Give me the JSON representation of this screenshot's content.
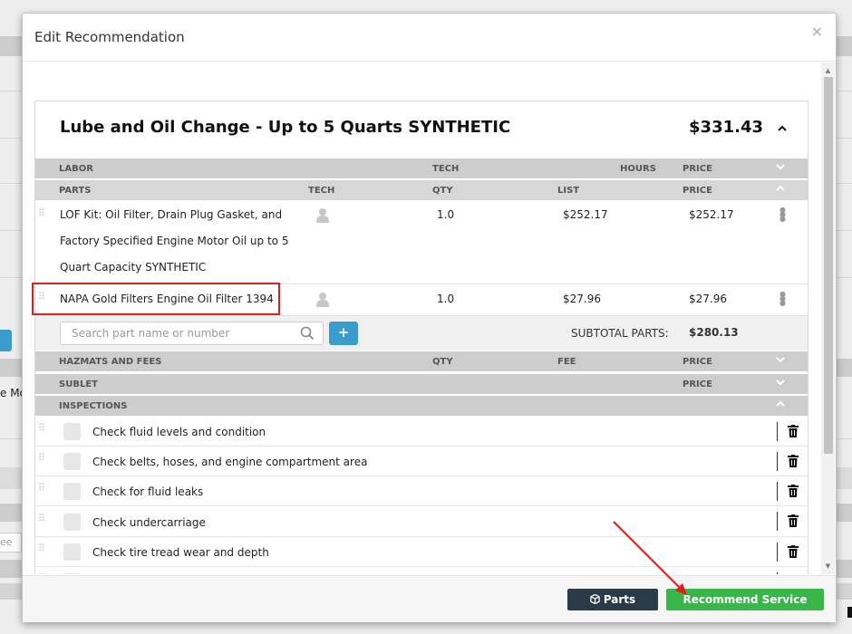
{
  "background": {
    "fragment_text": "e Mo",
    "input_fragment": "ee"
  },
  "modal": {
    "title": "Edit Recommendation",
    "close": "×"
  },
  "service": {
    "title": "Lube and Oil Change - Up to 5 Quarts SYNTHETIC",
    "price": "$331.43",
    "collapse_caret": "^"
  },
  "labor_header": {
    "label": "LABOR",
    "tech": "TECH",
    "hours": "HOURS",
    "price": "PRICE"
  },
  "parts_header": {
    "label": "PARTS",
    "tech": "TECH",
    "qty": "QTY",
    "list": "LIST",
    "price": "PRICE"
  },
  "parts": [
    {
      "line1": "LOF Kit: Oil Filter, Drain Plug Gasket, and",
      "line2": "Factory Specified Engine Motor Oil up to 5",
      "line3": "Quart Capacity SYNTHETIC",
      "qty": "1.0",
      "list": "$252.17",
      "price": "$252.17"
    },
    {
      "line1": "NAPA Gold Filters Engine Oil Filter 1394",
      "qty": "1.0",
      "list": "$27.96",
      "price": "$27.96"
    }
  ],
  "search": {
    "placeholder": "Search part name or number",
    "add_label": "+",
    "subtotal_label": "SUBTOTAL PARTS:",
    "subtotal_value": "$280.13"
  },
  "hazmat_header": {
    "label": "HAZMATS AND FEES",
    "qty": "QTY",
    "fee": "FEE",
    "price": "PRICE"
  },
  "sublet_header": {
    "label": "SUBLET",
    "price": "PRICE"
  },
  "inspections_header": {
    "label": "INSPECTIONS"
  },
  "inspections": [
    "Check fluid levels and condition",
    "Check belts, hoses, and engine compartment area",
    "Check for fluid leaks",
    "Check undercarriage",
    "Check tire tread wear and depth"
  ],
  "footer": {
    "parts_label": "Parts",
    "recommend_label": "Recommend Service"
  },
  "colors": {
    "accent_blue": "#3a9ccd",
    "recommend_green": "#3ab54a",
    "parts_dark": "#2a3a46",
    "annotation_red": "#e21b1b"
  }
}
